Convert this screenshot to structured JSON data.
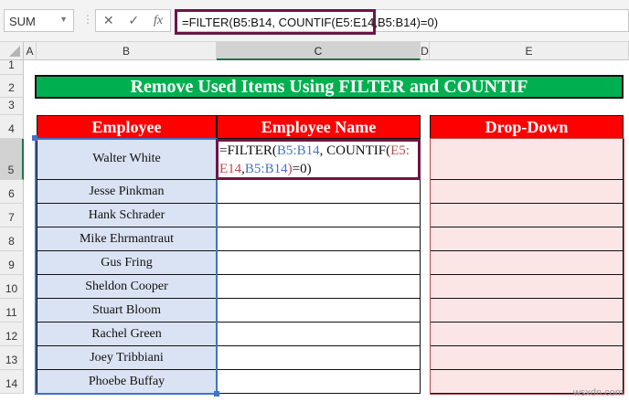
{
  "name_box": "SUM",
  "formula_bar": "=FILTER(B5:B14, COUNTIF(E5:E14,B5:B14)=0)",
  "formula_parts": {
    "p1": "=FILTER(",
    "p2": "B5:B14",
    ",p3": "",
    "p3": ", COUNTIF(",
    "p4": "E5:",
    "p5": "E14",
    ",p6": "",
    "p6": ",",
    "p7": "B5:B14",
    "p8": ")",
    "p9": "=0)"
  },
  "columns": [
    "A",
    "B",
    "C",
    "D",
    "E"
  ],
  "rows": [
    "1",
    "2",
    "3",
    "4",
    "5",
    "6",
    "7",
    "8",
    "9",
    "10",
    "11",
    "12",
    "13",
    "14"
  ],
  "title": "Remove Used Items Using FILTER and COUNTIF",
  "headers": {
    "employee": "Employee",
    "employee_name": "Employee Name",
    "drop_down": "Drop-Down"
  },
  "employees": [
    "Walter White",
    "Jesse Pinkman",
    "Hank Schrader",
    "Mike Ehrmantraut",
    "Gus Fring",
    "Sheldon Cooper",
    "Stuart Bloom",
    "Rachel Green",
    "Joey Tribbiani",
    "Phoebe Buffay"
  ],
  "watermark": "wsxdn.com"
}
